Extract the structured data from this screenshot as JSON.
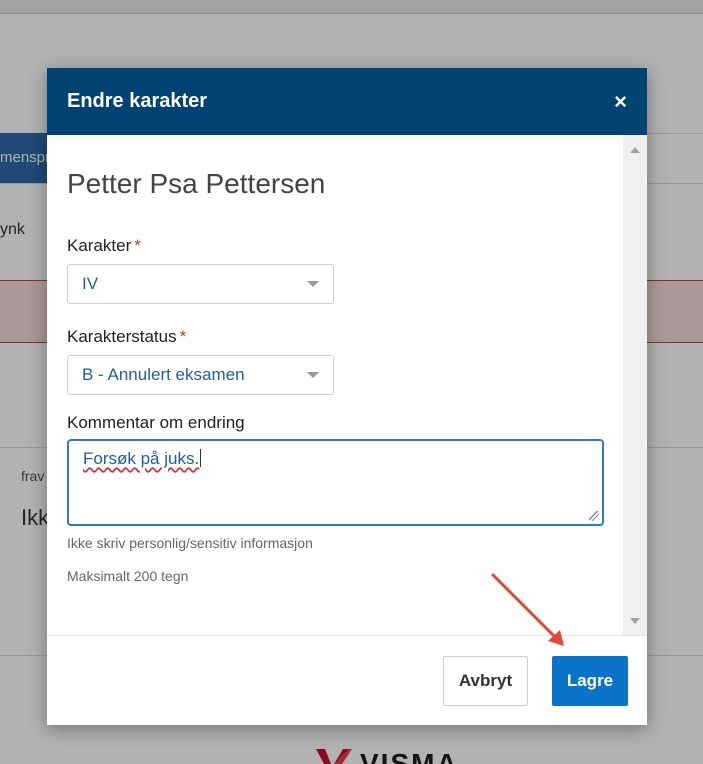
{
  "background": {
    "tab_partial": "menspr",
    "sub_partial": "ynk",
    "small_partial": "frav",
    "big_partial": "Ikk",
    "logo_text": "VISMA"
  },
  "modal": {
    "title": "Endre karakter",
    "close_glyph": "×",
    "student_name": "Petter Psa Pettersen",
    "grade": {
      "label": "Karakter",
      "required_mark": "*",
      "value": "IV"
    },
    "grade_status": {
      "label": "Karakterstatus",
      "required_mark": "*",
      "value": "B - Annulert eksamen"
    },
    "comment": {
      "label": "Kommentar om endring",
      "value": "Forsøk på juks."
    },
    "help_privacy": "Ikke skriv personlig/sensitiv informasjon",
    "help_max": "Maksimalt 200 tegn",
    "cancel_label": "Avbryt",
    "save_label": "Lagre"
  },
  "colors": {
    "header_bg": "#004272",
    "primary_button": "#0b74c9",
    "required": "#c0392b",
    "annotation_arrow": "#e04a3a"
  }
}
